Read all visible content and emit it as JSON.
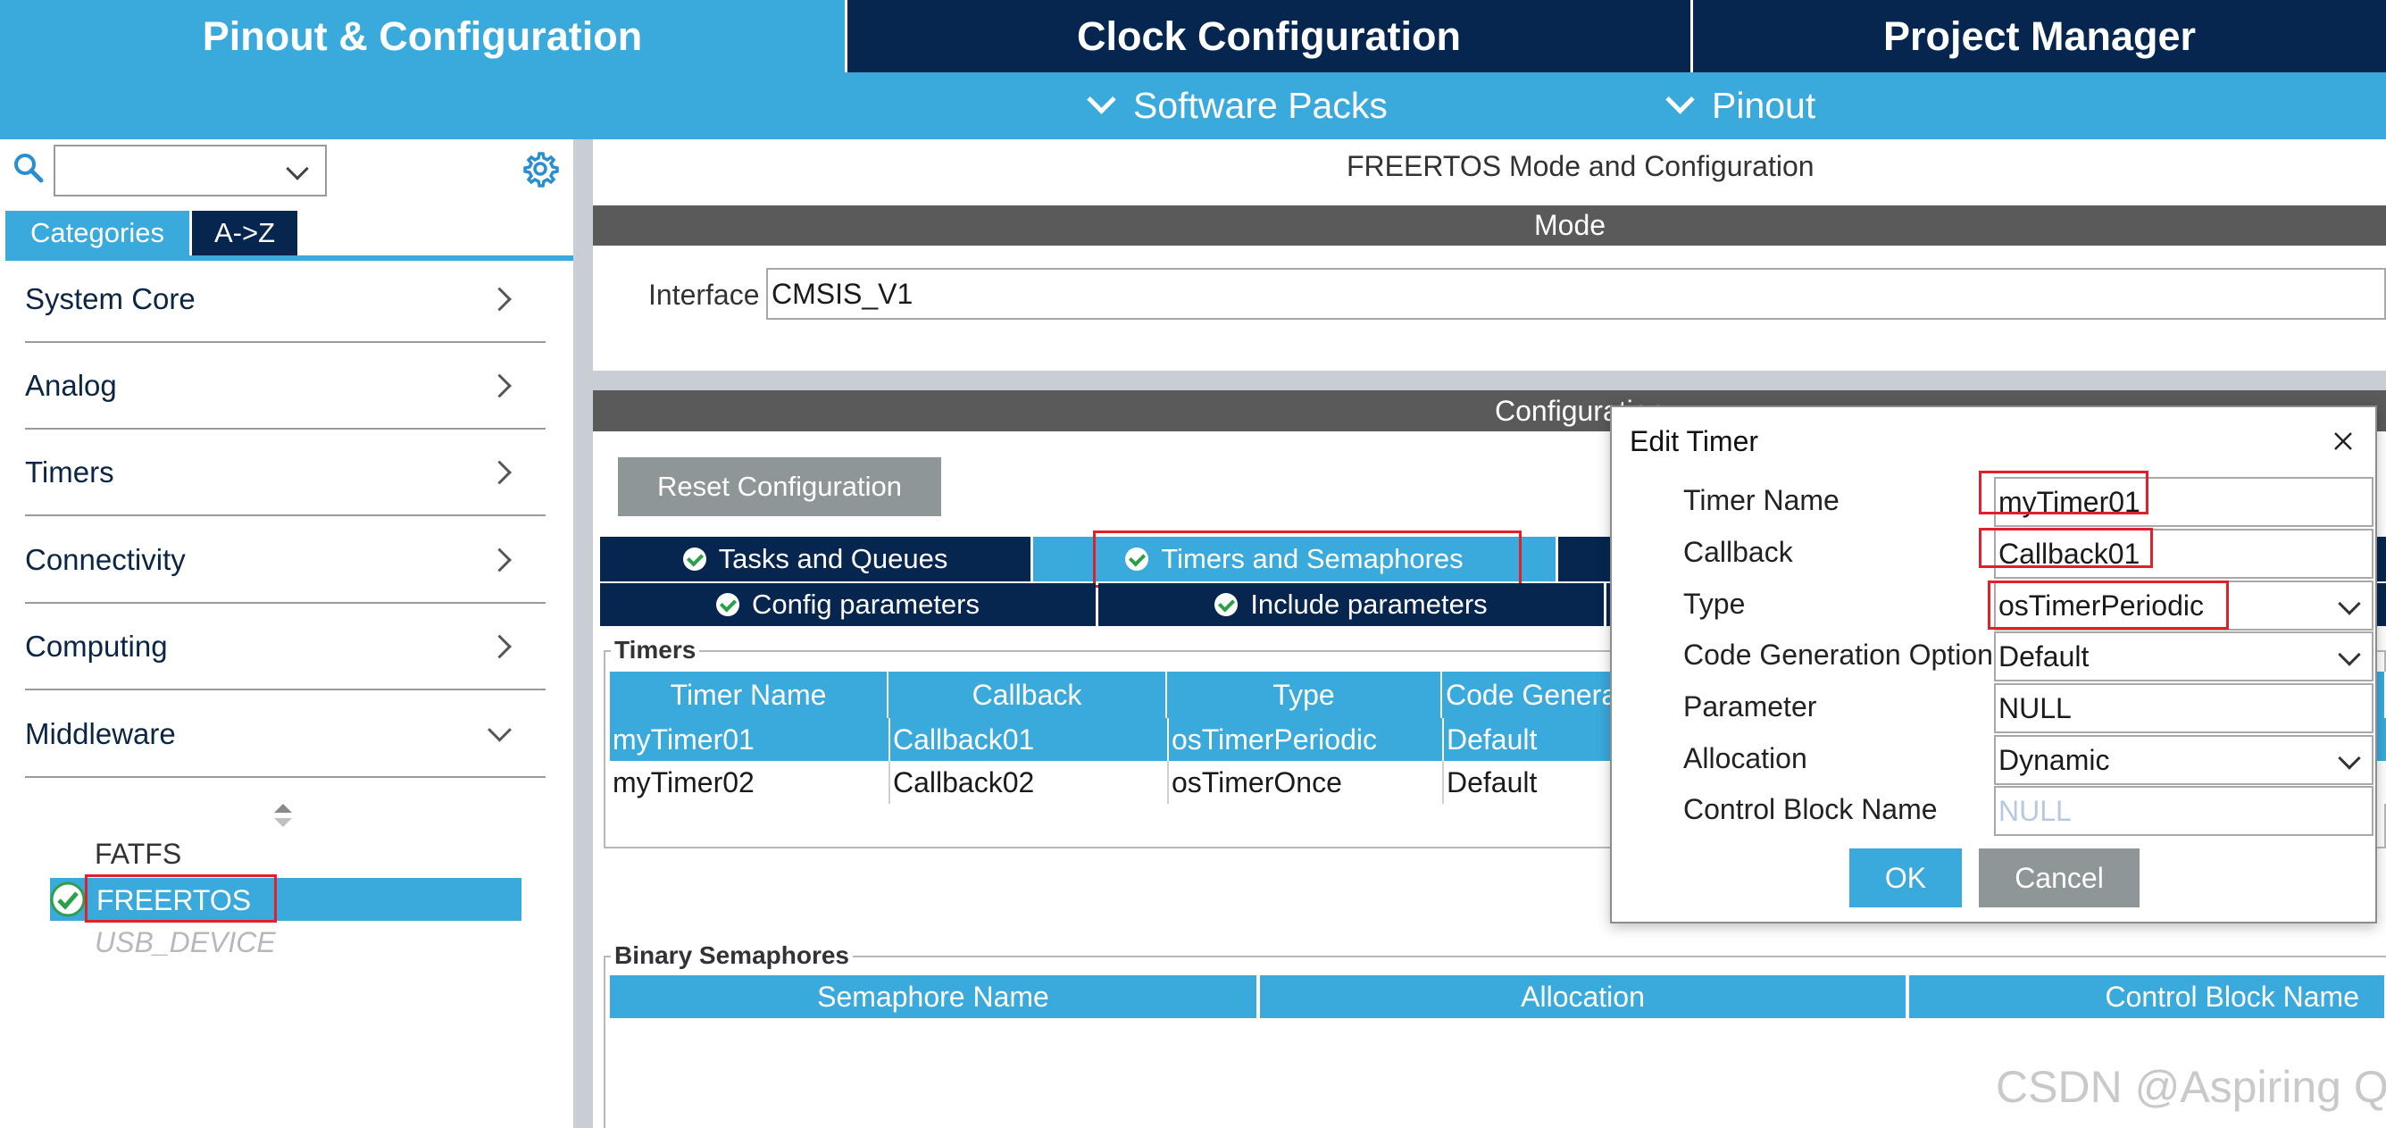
{
  "top_tabs": [
    {
      "label": "Pinout & Configuration"
    },
    {
      "label": "Clock Configuration"
    },
    {
      "label": "Project Manager"
    }
  ],
  "sub_menu": [
    {
      "label": "Software Packs"
    },
    {
      "label": "Pinout"
    }
  ],
  "left": {
    "search_value": "",
    "view_tabs": [
      "Categories",
      "A->Z"
    ],
    "categories": [
      "System Core",
      "Analog",
      "Timers",
      "Connectivity",
      "Computing",
      "Middleware"
    ],
    "middleware_items": [
      "FATFS",
      "FREERTOS",
      "USB_DEVICE"
    ]
  },
  "main": {
    "title": "FREERTOS Mode and Configuration",
    "mode_header": "Mode",
    "interface_label": "Interface",
    "interface_value": "CMSIS_V1",
    "config_header": "Configuration",
    "reset_button": "Reset Configuration",
    "tabs_row1": [
      "Tasks and Queues",
      "Timers and Semaphores"
    ],
    "tabs_row2": [
      "Config parameters",
      "Include parameters"
    ],
    "timers_group": "Timers",
    "timers_columns": [
      "Timer Name",
      "Callback",
      "Type",
      "Code Genera"
    ],
    "timers_rows": [
      [
        "myTimer01",
        "Callback01",
        "osTimerPeriodic",
        "Default"
      ],
      [
        "myTimer02",
        "Callback02",
        "osTimerOnce",
        "Default"
      ]
    ],
    "semaphores_group": "Binary Semaphores",
    "semaphores_columns": [
      "Semaphore Name",
      "Allocation",
      "Control Block Name"
    ]
  },
  "dialog": {
    "title": "Edit Timer",
    "fields": [
      {
        "label": "Timer Name",
        "value": "myTimer01"
      },
      {
        "label": "Callback",
        "value": "Callback01"
      },
      {
        "label": "Type",
        "value": "osTimerPeriodic"
      },
      {
        "label": "Code Generation Option",
        "value": "Default"
      },
      {
        "label": "Parameter",
        "value": "NULL"
      },
      {
        "label": "Allocation",
        "value": "Dynamic"
      },
      {
        "label": "Control Block Name",
        "value": "NULL"
      }
    ],
    "ok_label": "OK",
    "cancel_label": "Cancel"
  },
  "watermark": "CSDN @Aspiring Q",
  "colors": {
    "navy": "#062650",
    "accent_blue": "#3aaadd",
    "header_gray": "#5a5a5a",
    "highlight_red": "#e0202a",
    "button_gray": "#8f9698"
  }
}
